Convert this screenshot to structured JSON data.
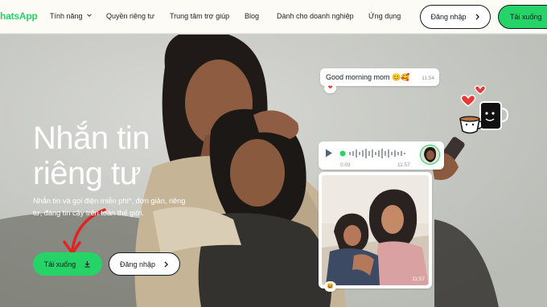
{
  "nav": {
    "logo": "hatsApp",
    "links": [
      {
        "label": "Tính năng",
        "dropdown": true
      },
      {
        "label": "Quyền riêng tư"
      },
      {
        "label": "Trung tâm trợ giúp"
      },
      {
        "label": "Blog"
      },
      {
        "label": "Dành cho doanh nghiệp"
      },
      {
        "label": "Ứng dụng"
      }
    ],
    "login_label": "Đăng nhập",
    "download_label": "Tải xuống"
  },
  "hero": {
    "headline_line1": "Nhắn tin",
    "headline_line2": "riêng tư",
    "subtitle": "Nhắn tin và gọi điện miễn phí*, đơn giản, riêng tư, đáng tin cậy trên toàn thế giới.",
    "download_label": "Tải xuống",
    "login_label": "Đăng nhập"
  },
  "chat": {
    "text_message": "Good morning mom 😊🥰",
    "text_time": "11:54",
    "text_reaction": "heart",
    "voice_elapsed": "0:03",
    "voice_time": "11:57",
    "photo_time": "11:57",
    "photo_reaction": "smile"
  },
  "colors": {
    "brand_green": "#25d366",
    "nav_bg": "#fcfbf6",
    "text_dark": "#111b21",
    "arrow_red": "#e02424"
  },
  "icons": {
    "dropdown": "chevron-down-icon",
    "login_arrow": "chevron-right-icon",
    "download": "download-icon",
    "play": "play-icon",
    "hearts": "hearts-sticker-icon",
    "coffee": "coffee-cups-sticker-icon"
  }
}
